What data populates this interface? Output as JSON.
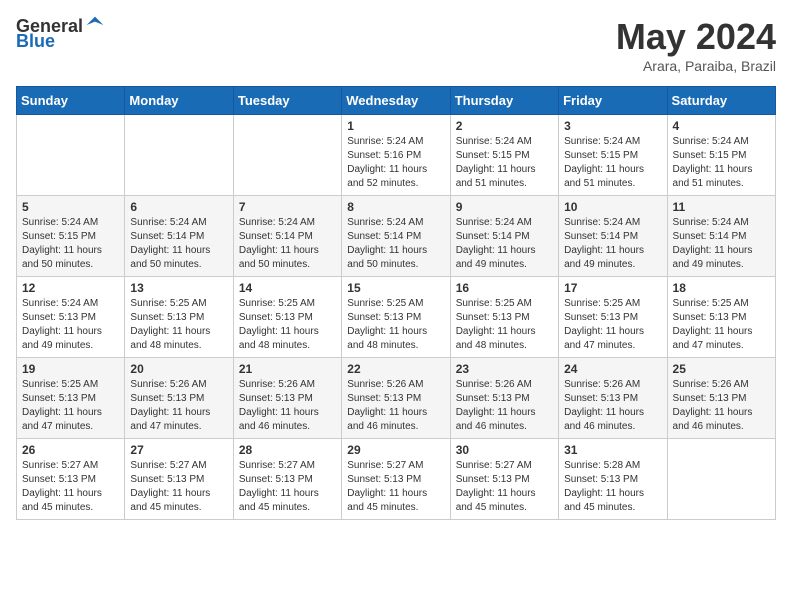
{
  "header": {
    "logo_general": "General",
    "logo_blue": "Blue",
    "month_title": "May 2024",
    "subtitle": "Arara, Paraiba, Brazil"
  },
  "calendar": {
    "days_of_week": [
      "Sunday",
      "Monday",
      "Tuesday",
      "Wednesday",
      "Thursday",
      "Friday",
      "Saturday"
    ],
    "weeks": [
      [
        {
          "day": "",
          "info": ""
        },
        {
          "day": "",
          "info": ""
        },
        {
          "day": "",
          "info": ""
        },
        {
          "day": "1",
          "info": "Sunrise: 5:24 AM\nSunset: 5:16 PM\nDaylight: 11 hours\nand 52 minutes."
        },
        {
          "day": "2",
          "info": "Sunrise: 5:24 AM\nSunset: 5:15 PM\nDaylight: 11 hours\nand 51 minutes."
        },
        {
          "day": "3",
          "info": "Sunrise: 5:24 AM\nSunset: 5:15 PM\nDaylight: 11 hours\nand 51 minutes."
        },
        {
          "day": "4",
          "info": "Sunrise: 5:24 AM\nSunset: 5:15 PM\nDaylight: 11 hours\nand 51 minutes."
        }
      ],
      [
        {
          "day": "5",
          "info": "Sunrise: 5:24 AM\nSunset: 5:15 PM\nDaylight: 11 hours\nand 50 minutes."
        },
        {
          "day": "6",
          "info": "Sunrise: 5:24 AM\nSunset: 5:14 PM\nDaylight: 11 hours\nand 50 minutes."
        },
        {
          "day": "7",
          "info": "Sunrise: 5:24 AM\nSunset: 5:14 PM\nDaylight: 11 hours\nand 50 minutes."
        },
        {
          "day": "8",
          "info": "Sunrise: 5:24 AM\nSunset: 5:14 PM\nDaylight: 11 hours\nand 50 minutes."
        },
        {
          "day": "9",
          "info": "Sunrise: 5:24 AM\nSunset: 5:14 PM\nDaylight: 11 hours\nand 49 minutes."
        },
        {
          "day": "10",
          "info": "Sunrise: 5:24 AM\nSunset: 5:14 PM\nDaylight: 11 hours\nand 49 minutes."
        },
        {
          "day": "11",
          "info": "Sunrise: 5:24 AM\nSunset: 5:14 PM\nDaylight: 11 hours\nand 49 minutes."
        }
      ],
      [
        {
          "day": "12",
          "info": "Sunrise: 5:24 AM\nSunset: 5:13 PM\nDaylight: 11 hours\nand 49 minutes."
        },
        {
          "day": "13",
          "info": "Sunrise: 5:25 AM\nSunset: 5:13 PM\nDaylight: 11 hours\nand 48 minutes."
        },
        {
          "day": "14",
          "info": "Sunrise: 5:25 AM\nSunset: 5:13 PM\nDaylight: 11 hours\nand 48 minutes."
        },
        {
          "day": "15",
          "info": "Sunrise: 5:25 AM\nSunset: 5:13 PM\nDaylight: 11 hours\nand 48 minutes."
        },
        {
          "day": "16",
          "info": "Sunrise: 5:25 AM\nSunset: 5:13 PM\nDaylight: 11 hours\nand 48 minutes."
        },
        {
          "day": "17",
          "info": "Sunrise: 5:25 AM\nSunset: 5:13 PM\nDaylight: 11 hours\nand 47 minutes."
        },
        {
          "day": "18",
          "info": "Sunrise: 5:25 AM\nSunset: 5:13 PM\nDaylight: 11 hours\nand 47 minutes."
        }
      ],
      [
        {
          "day": "19",
          "info": "Sunrise: 5:25 AM\nSunset: 5:13 PM\nDaylight: 11 hours\nand 47 minutes."
        },
        {
          "day": "20",
          "info": "Sunrise: 5:26 AM\nSunset: 5:13 PM\nDaylight: 11 hours\nand 47 minutes."
        },
        {
          "day": "21",
          "info": "Sunrise: 5:26 AM\nSunset: 5:13 PM\nDaylight: 11 hours\nand 46 minutes."
        },
        {
          "day": "22",
          "info": "Sunrise: 5:26 AM\nSunset: 5:13 PM\nDaylight: 11 hours\nand 46 minutes."
        },
        {
          "day": "23",
          "info": "Sunrise: 5:26 AM\nSunset: 5:13 PM\nDaylight: 11 hours\nand 46 minutes."
        },
        {
          "day": "24",
          "info": "Sunrise: 5:26 AM\nSunset: 5:13 PM\nDaylight: 11 hours\nand 46 minutes."
        },
        {
          "day": "25",
          "info": "Sunrise: 5:26 AM\nSunset: 5:13 PM\nDaylight: 11 hours\nand 46 minutes."
        }
      ],
      [
        {
          "day": "26",
          "info": "Sunrise: 5:27 AM\nSunset: 5:13 PM\nDaylight: 11 hours\nand 45 minutes."
        },
        {
          "day": "27",
          "info": "Sunrise: 5:27 AM\nSunset: 5:13 PM\nDaylight: 11 hours\nand 45 minutes."
        },
        {
          "day": "28",
          "info": "Sunrise: 5:27 AM\nSunset: 5:13 PM\nDaylight: 11 hours\nand 45 minutes."
        },
        {
          "day": "29",
          "info": "Sunrise: 5:27 AM\nSunset: 5:13 PM\nDaylight: 11 hours\nand 45 minutes."
        },
        {
          "day": "30",
          "info": "Sunrise: 5:27 AM\nSunset: 5:13 PM\nDaylight: 11 hours\nand 45 minutes."
        },
        {
          "day": "31",
          "info": "Sunrise: 5:28 AM\nSunset: 5:13 PM\nDaylight: 11 hours\nand 45 minutes."
        },
        {
          "day": "",
          "info": ""
        }
      ]
    ]
  }
}
